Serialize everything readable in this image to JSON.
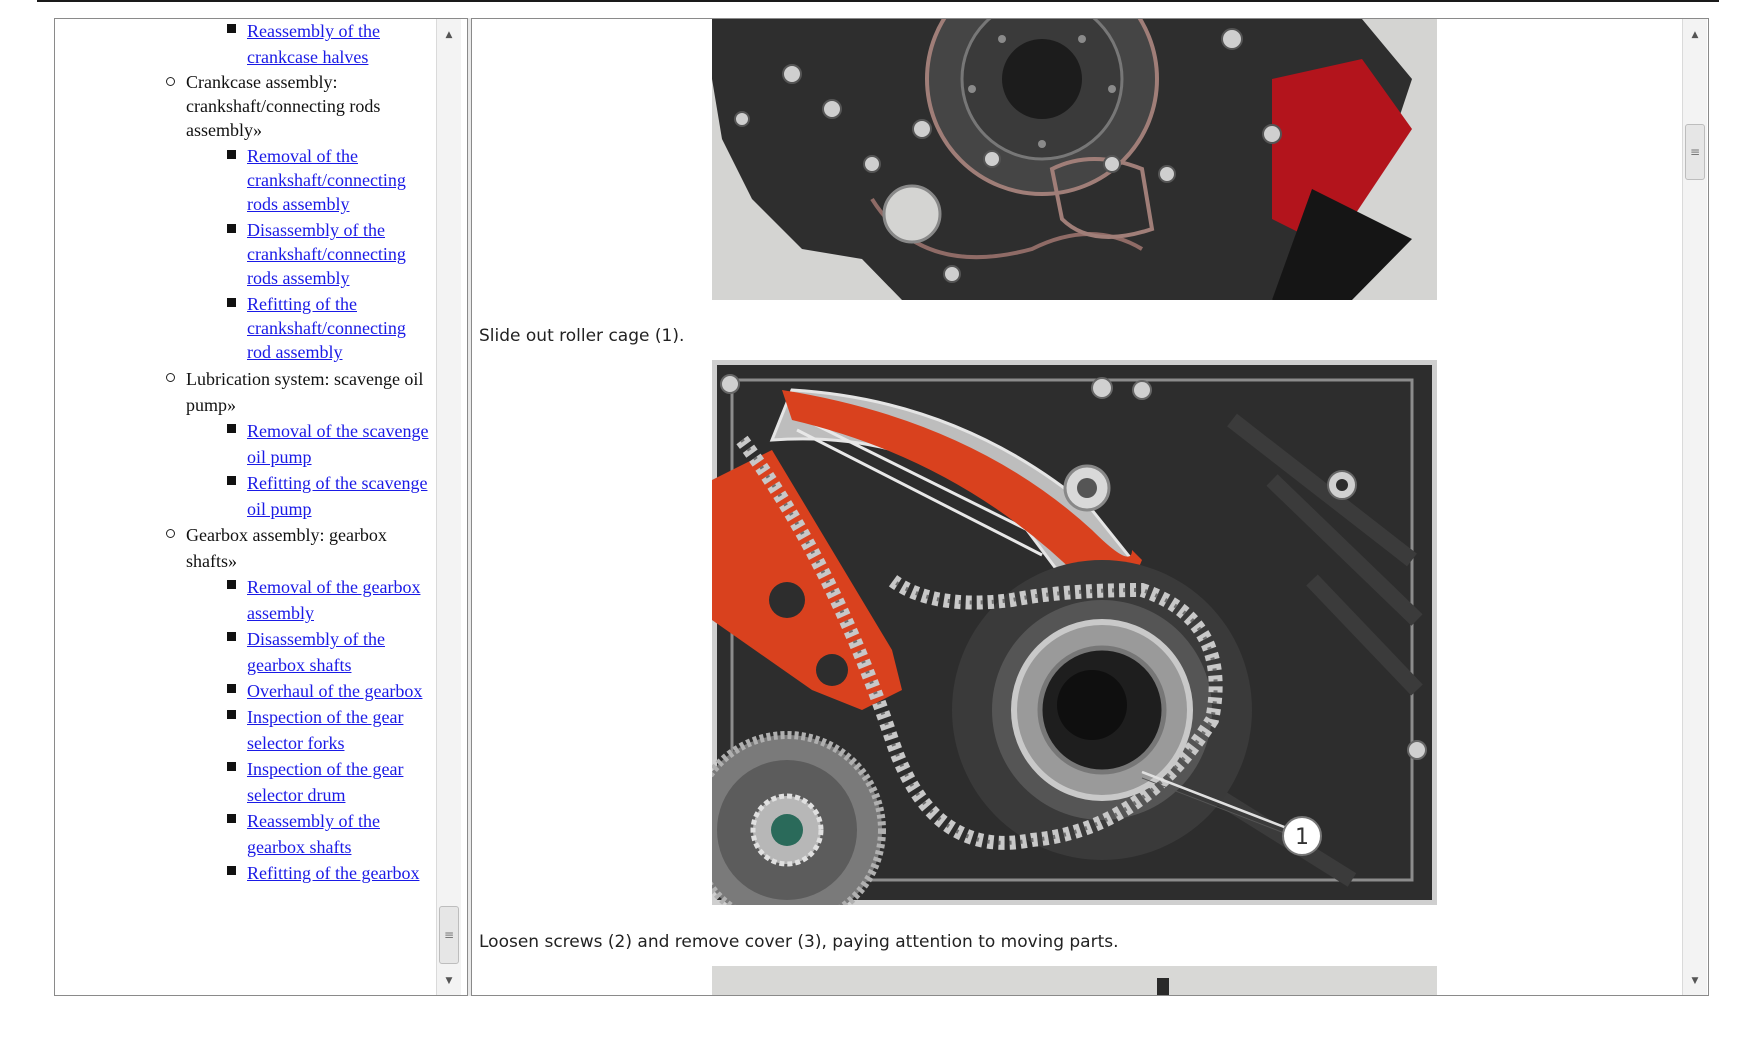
{
  "toc": {
    "items": [
      {
        "level": 3,
        "text": "Reassembly of the crankcase halves",
        "lines": [
          "Reassembly of the",
          "crankcase halves"
        ],
        "link": true
      },
      {
        "level": 2,
        "text": "Crankcase assembly: crankshaft/connecting rods assembly»",
        "lines": [
          "Crankcase assembly:",
          "crankshaft/connecting rods",
          "assembly»"
        ],
        "link": false
      },
      {
        "level": 3,
        "text": "Removal of the crankshaft/connecting rods assembly",
        "lines": [
          "Removal of the",
          "crankshaft/connecting",
          "rods assembly"
        ],
        "link": true
      },
      {
        "level": 3,
        "text": "Disassembly of the crankshaft/connecting rods assembly",
        "lines": [
          "Disassembly of the",
          "crankshaft/connecting",
          "rods assembly"
        ],
        "link": true
      },
      {
        "level": 3,
        "text": "Refitting of the crankshaft/connecting rod assembly",
        "lines": [
          "Refitting of the",
          "crankshaft/connecting",
          "rod assembly"
        ],
        "link": true
      },
      {
        "level": 2,
        "text": "Lubrication system: scavenge oil pump»",
        "lines": [
          "Lubrication system: scavenge oil",
          "pump»"
        ],
        "link": false
      },
      {
        "level": 3,
        "text": "Removal of the scavenge oil pump",
        "lines": [
          "Removal of the scavenge",
          "oil pump"
        ],
        "link": true
      },
      {
        "level": 3,
        "text": "Refitting of the scavenge oil pump",
        "lines": [
          "Refitting of the scavenge",
          "oil pump"
        ],
        "link": true
      },
      {
        "level": 2,
        "text": "Gearbox assembly: gearbox shafts»",
        "lines": [
          "Gearbox assembly: gearbox",
          "shafts»"
        ],
        "link": false
      },
      {
        "level": 3,
        "text": "Removal of the gearbox assembly",
        "lines": [
          "Removal of the gearbox",
          "assembly"
        ],
        "link": true
      },
      {
        "level": 3,
        "text": "Disassembly of the gearbox shafts",
        "lines": [
          "Disassembly of the",
          "gearbox shafts"
        ],
        "link": true
      },
      {
        "level": 3,
        "text": "Overhaul of the gearbox",
        "lines": [
          "Overhaul of the gearbox"
        ],
        "link": true
      },
      {
        "level": 3,
        "text": "Inspection of the gear selector forks",
        "lines": [
          "Inspection of the gear",
          "selector forks"
        ],
        "link": true
      },
      {
        "level": 3,
        "text": "Inspection of the gear selector drum",
        "lines": [
          "Inspection of the gear",
          "selector drum"
        ],
        "link": true
      },
      {
        "level": 3,
        "text": "Reassembly of the gearbox shafts",
        "lines": [
          "Reassembly of the",
          "gearbox shafts"
        ],
        "link": true
      },
      {
        "level": 3,
        "text": "Refitting of the gearbox",
        "lines": [
          "Refitting of the gearbox"
        ],
        "link": true
      }
    ]
  },
  "content": {
    "paragraph_1": "Slide out roller cage (1).",
    "paragraph_2": "Loosen screws (2) and remove cover (3), paying attention to moving parts.",
    "callout_1": "1"
  },
  "colors": {
    "link": "#1a1ae6",
    "engine_dark": "#2b2b2b",
    "engine_red": "#d9411e",
    "photo_background": "#d4d4d2"
  }
}
